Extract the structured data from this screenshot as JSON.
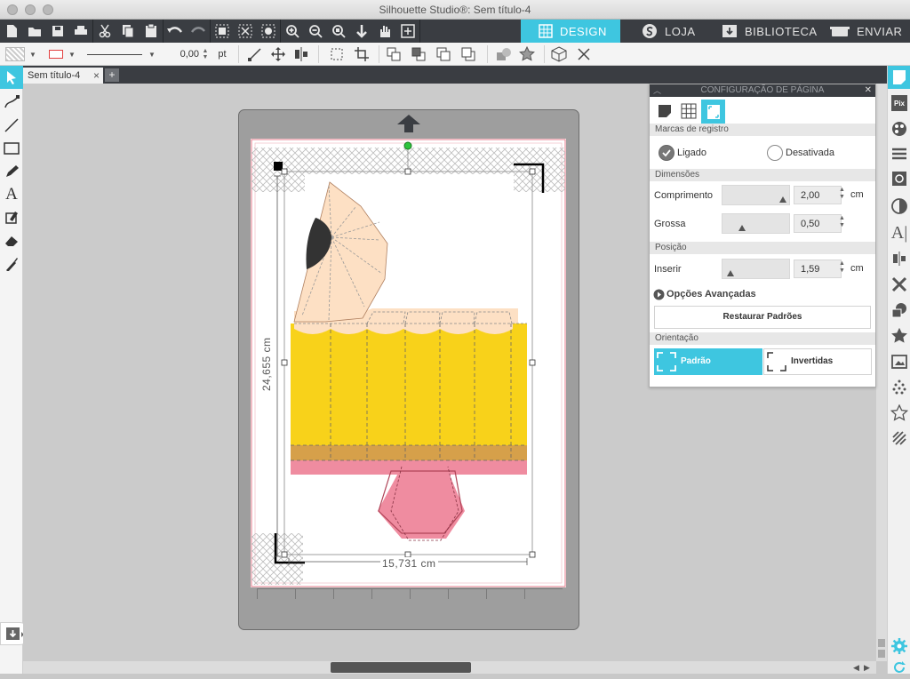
{
  "window": {
    "title": "Silhouette Studio®: Sem título-4"
  },
  "nav_tabs": [
    {
      "label": "DESIGN",
      "icon": "grid-icon",
      "active": true
    },
    {
      "label": "LOJA",
      "icon": "silhouette-s-icon",
      "active": false
    },
    {
      "label": "BIBLIOTECA",
      "icon": "download-box-icon",
      "active": false
    },
    {
      "label": "ENVIAR",
      "icon": "cutter-icon",
      "active": false
    }
  ],
  "options_bar": {
    "line_width": "0,00",
    "line_unit": "pt"
  },
  "document_tab": {
    "name": "Sem título-4",
    "close": "×",
    "add": "+"
  },
  "canvas": {
    "height_dimension": "24,655 cm",
    "width_dimension": "15,731 cm"
  },
  "page_panel": {
    "title": "CONFIGURAÇÃO DE PÁGINA",
    "sections": {
      "registration": "Marcas de registro",
      "dimensions": "Dimensões",
      "position": "Posição",
      "orientation": "Orientação"
    },
    "registration_options": [
      {
        "label": "Ligado",
        "selected": true
      },
      {
        "label": "Desativada",
        "selected": false
      }
    ],
    "dimension_fields": [
      {
        "label": "Comprimento",
        "value": "2,00",
        "unit": "cm",
        "level": 0.95
      },
      {
        "label": "Grossa",
        "value": "0,50",
        "unit": "",
        "level": 0.25
      }
    ],
    "position_fields": [
      {
        "label": "Inserir",
        "value": "1,59",
        "unit": "cm",
        "level": 0.05
      }
    ],
    "advanced_options": "Opções Avançadas",
    "restore_defaults": "Restaurar Padrões",
    "orientation_options": [
      {
        "label": "Padrão",
        "selected": true
      },
      {
        "label": "Invertidas",
        "selected": false
      }
    ]
  },
  "colors": {
    "accent": "#3ec6e0",
    "toolbar": "#3a3d42",
    "design_yellow": "#f8d21a",
    "design_pink": "#ef8ca0",
    "design_peach": "#fde0c4"
  }
}
